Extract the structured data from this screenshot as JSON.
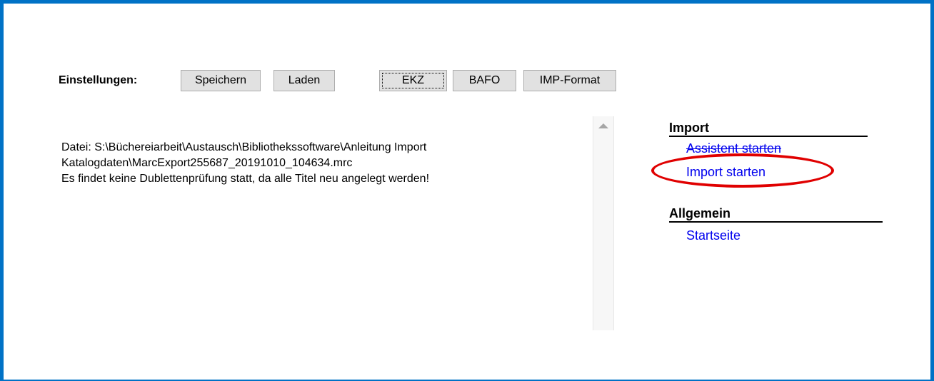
{
  "settings": {
    "label": "Einstellungen:",
    "buttons": {
      "save": "Speichern",
      "load": "Laden",
      "ekz": "EKZ",
      "bafo": "BAFO",
      "imp_format": "IMP-Format"
    }
  },
  "messages": [
    "Datei: S:\\Büchereiarbeit\\Austausch\\Bibliothekssoftware\\Anleitung Import",
    "Katalogdaten\\MarcExport255687_20191010_104634.mrc",
    "Es findet keine Dublettenprüfung statt, da alle Titel neu angelegt werden!"
  ],
  "sidebar": {
    "import": {
      "title": "Import",
      "links": [
        "Assistent starten",
        "Import starten"
      ]
    },
    "general": {
      "title": "Allgemein",
      "links": [
        "Startseite"
      ]
    }
  },
  "colors": {
    "frame": "#0072c6",
    "link": "#0000ee",
    "annotation": "#e00000"
  },
  "icons": [
    "scroll-up-arrow-icon"
  ]
}
